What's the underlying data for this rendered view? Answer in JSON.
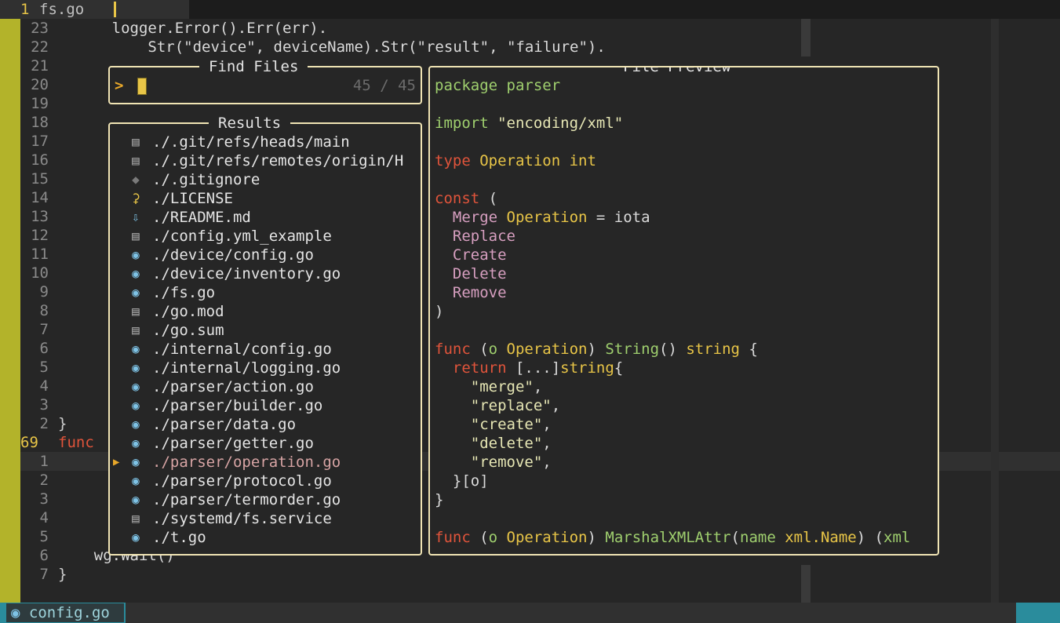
{
  "tabline": {
    "number": "1",
    "filename": "fs.go"
  },
  "editor": {
    "lines": [
      {
        "num": "23",
        "html_plain": "      logger.Error().Err(err)."
      },
      {
        "num": "22",
        "html_plain": "          Str(\"device\", deviceName).Str(\"result\", \"failure\")."
      },
      {
        "num": "21",
        "html_plain": ""
      },
      {
        "num": "20",
        "html_plain": ""
      },
      {
        "num": "19",
        "html_plain": ""
      },
      {
        "num": "18",
        "html_plain": ""
      },
      {
        "num": "17",
        "html_plain": ""
      },
      {
        "num": "16",
        "html_plain": ""
      },
      {
        "num": "15",
        "html_plain": ""
      },
      {
        "num": "14",
        "html_plain": ""
      },
      {
        "num": "13",
        "html_plain": ""
      },
      {
        "num": "12",
        "html_plain": ""
      },
      {
        "num": "11",
        "html_plain": ""
      },
      {
        "num": "10",
        "html_plain": ""
      },
      {
        "num": "9",
        "html_plain": ""
      },
      {
        "num": "8",
        "html_plain": ""
      },
      {
        "num": "7",
        "html_plain": ""
      },
      {
        "num": "6",
        "html_plain": ""
      },
      {
        "num": "5",
        "html_plain": ""
      },
      {
        "num": "4",
        "html_plain": ""
      },
      {
        "num": "3",
        "html_plain": ""
      },
      {
        "num": "2",
        "html_plain": "}"
      },
      {
        "num": "69",
        "html_plain": "func"
      },
      {
        "num": "1",
        "html_plain": ""
      },
      {
        "num": "2",
        "html_plain": ""
      },
      {
        "num": "3",
        "html_plain": ""
      },
      {
        "num": "4",
        "html_plain": ""
      },
      {
        "num": "5",
        "html_plain": ""
      },
      {
        "num": "6",
        "html_plain": "    wg.Wait()"
      },
      {
        "num": "7",
        "html_plain": "}"
      }
    ]
  },
  "find_files": {
    "title": "Find Files",
    "prompt": ">",
    "count": "45 / 45"
  },
  "results": {
    "title": "Results",
    "items": [
      {
        "icon": "file-icon",
        "path": "./.git/refs/heads/main"
      },
      {
        "icon": "file-icon",
        "path": "./.git/refs/remotes/origin/H"
      },
      {
        "icon": "git-icon",
        "path": "./.gitignore"
      },
      {
        "icon": "license-icon",
        "path": "./LICENSE"
      },
      {
        "icon": "markdown-icon",
        "path": "./README.md"
      },
      {
        "icon": "file-icon",
        "path": "./config.yml_example"
      },
      {
        "icon": "go-icon",
        "path": "./device/config.go"
      },
      {
        "icon": "go-icon",
        "path": "./device/inventory.go"
      },
      {
        "icon": "go-icon",
        "path": "./fs.go"
      },
      {
        "icon": "file-icon",
        "path": "./go.mod"
      },
      {
        "icon": "file-icon",
        "path": "./go.sum"
      },
      {
        "icon": "go-icon",
        "path": "./internal/config.go"
      },
      {
        "icon": "go-icon",
        "path": "./internal/logging.go"
      },
      {
        "icon": "go-icon",
        "path": "./parser/action.go"
      },
      {
        "icon": "go-icon",
        "path": "./parser/builder.go"
      },
      {
        "icon": "go-icon",
        "path": "./parser/data.go"
      },
      {
        "icon": "go-icon",
        "path": "./parser/getter.go"
      },
      {
        "icon": "go-icon",
        "path": "./parser/operation.go",
        "selected": true
      },
      {
        "icon": "go-icon",
        "path": "./parser/protocol.go"
      },
      {
        "icon": "go-icon",
        "path": "./parser/termorder.go"
      },
      {
        "icon": "file-icon",
        "path": "./systemd/fs.service"
      },
      {
        "icon": "go-icon",
        "path": "./t.go"
      }
    ]
  },
  "preview": {
    "title": "File Preview"
  },
  "statusbar": {
    "filename": "config.go"
  },
  "colors": {
    "accent": "#e8c547",
    "border": "#f0e4b4",
    "status": "#2a8c9c"
  }
}
